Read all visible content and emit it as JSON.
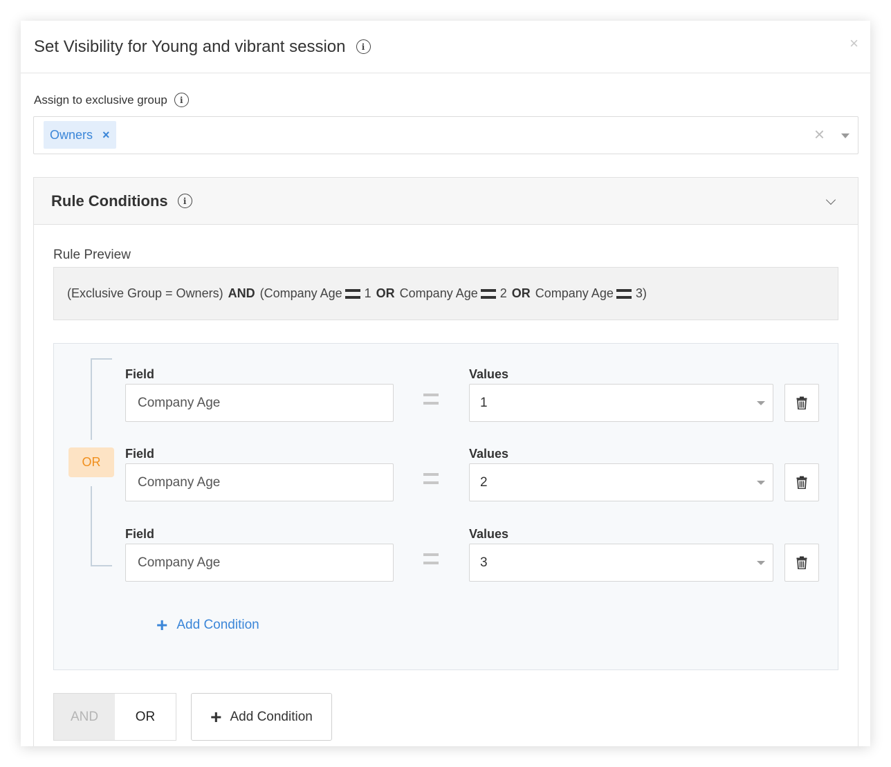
{
  "modal": {
    "title": "Set Visibility for Young and vibrant session",
    "close": "×"
  },
  "exclusive_group": {
    "label": "Assign to exclusive group",
    "selected_tag": "Owners",
    "tag_remove": "×",
    "clear": "×"
  },
  "rule_conditions": {
    "title": "Rule Conditions",
    "preview_label": "Rule Preview",
    "preview": {
      "group_part": "(Exclusive Group = Owners)",
      "and_op": "AND",
      "open": "(Company Age",
      "v1": "1",
      "or1": "OR",
      "mid1": "Company Age",
      "v2": "2",
      "or2": "OR",
      "mid2": "Company Age",
      "v3": "3)"
    },
    "group_operator": "OR",
    "conditions": [
      {
        "field_label": "Field",
        "field_value": "Company Age",
        "values_label": "Values",
        "value": "1"
      },
      {
        "field_label": "Field",
        "field_value": "Company Age",
        "values_label": "Values",
        "value": "2"
      },
      {
        "field_label": "Field",
        "field_value": "Company Age",
        "values_label": "Values",
        "value": "3"
      }
    ],
    "add_condition_inner": "Add Condition",
    "toggle": {
      "and": "AND",
      "or": "OR",
      "active": "OR"
    },
    "add_condition_outer": "Add Condition"
  },
  "icons": {
    "info": "info-icon",
    "delete": "trash-icon",
    "plus": "plus-icon",
    "caret": "caret-down-icon",
    "chevron": "chevron-down-icon"
  },
  "colors": {
    "accent": "#3b86d8",
    "tag_bg": "#e3eefb",
    "or_badge_bg": "#fde3c4",
    "or_badge_text": "#f08f1d"
  }
}
